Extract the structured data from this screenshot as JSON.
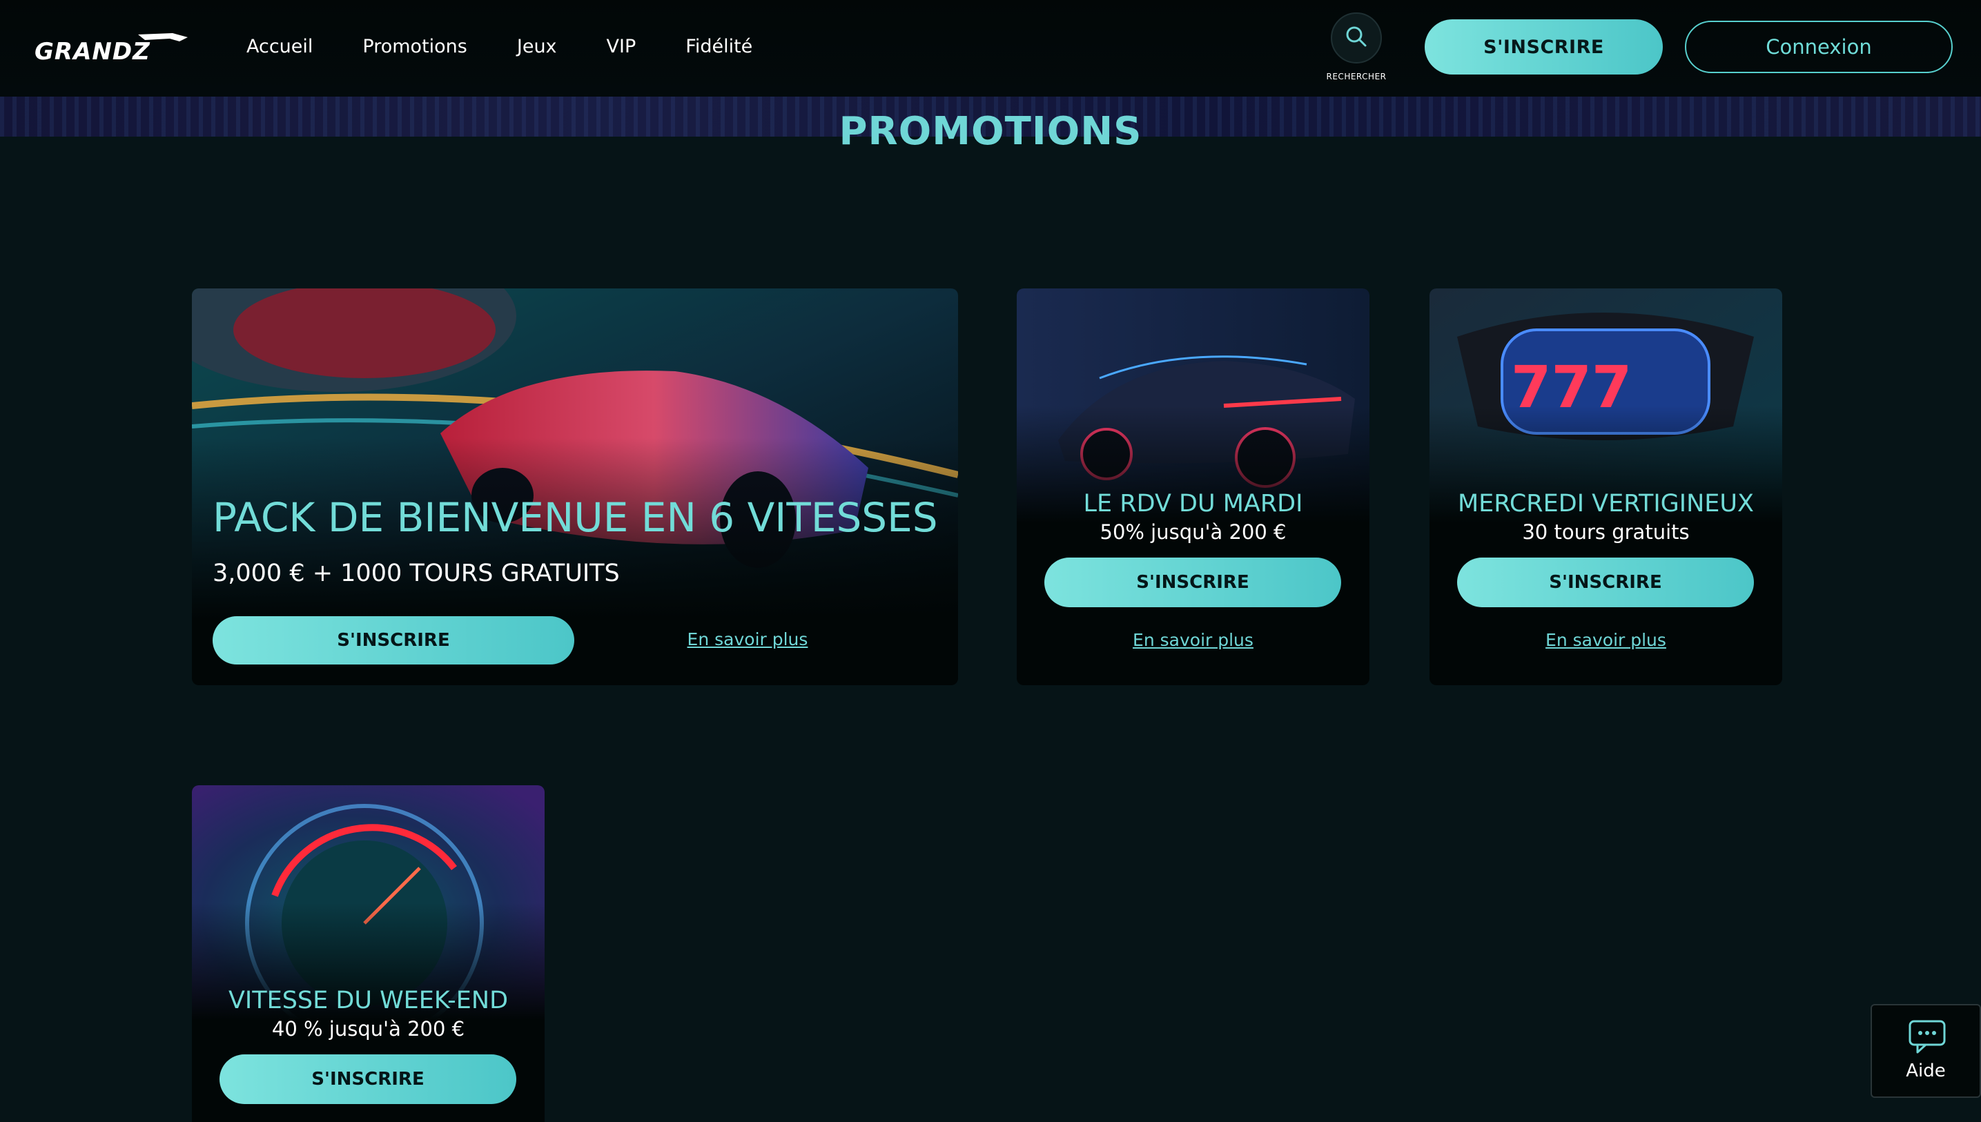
{
  "header": {
    "logo_alt": "GRANDZ",
    "nav": [
      "Accueil",
      "Promotions",
      "Jeux",
      "VIP",
      "Fidélité"
    ],
    "search_label": "RECHERCHER",
    "signup_label": "S'INSCRIRE",
    "login_label": "Connexion"
  },
  "page_title": "PROMOTIONS",
  "promos": [
    {
      "title": "PACK DE BIENVENUE EN 6 VITESSES",
      "subtitle": "3,000 € + 1000 TOURS GRATUITS",
      "button": "S'INSCRIRE",
      "link": "En savoir plus"
    },
    {
      "title": "LE RDV DU MARDI",
      "subtitle": "50% jusqu'à 200 €",
      "button": "S'INSCRIRE",
      "link": "En savoir plus"
    },
    {
      "title": "MERCREDI VERTIGINEUX",
      "subtitle": "30 tours gratuits",
      "button": "S'INSCRIRE",
      "link": "En savoir plus"
    },
    {
      "title": "VITESSE DU WEEK-END",
      "subtitle": "40 % jusqu'à 200 €",
      "button": "S'INSCRIRE"
    }
  ],
  "help": {
    "label": "Aide"
  },
  "colors": {
    "accent": "#6fd6d6",
    "background": "#061417",
    "button": "#5fd2d0"
  }
}
